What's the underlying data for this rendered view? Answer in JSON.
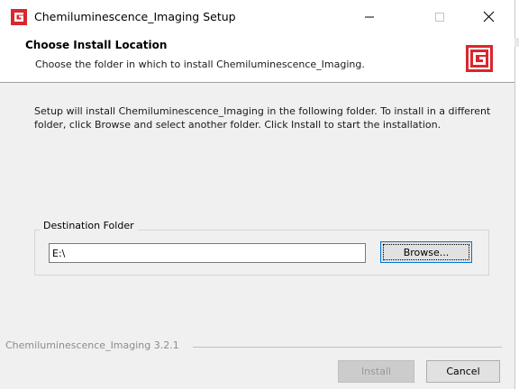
{
  "window": {
    "title": "Chemiluminescence_Imaging Setup",
    "controls": {
      "minimize": "—",
      "maximize": "☐",
      "close": "✕"
    }
  },
  "header": {
    "title": "Choose Install Location",
    "subtitle": "Choose the folder in which to install Chemiluminescence_Imaging."
  },
  "body": {
    "description": "Setup will install Chemiluminescence_Imaging in the following folder. To install in a different folder, click Browse and select another folder. Click Install to start the installation."
  },
  "destination": {
    "group_label": "Destination Folder",
    "path": "E:\\",
    "browse_label": "Browse..."
  },
  "footer": {
    "brand_text": "Chemiluminescence_Imaging 3.2.1",
    "install_label": "Install",
    "cancel_label": "Cancel"
  },
  "colors": {
    "brand_red": "#d9272e",
    "focus_blue": "#0078d7"
  },
  "icons": {
    "app": "app-logo-icon",
    "header": "header-logo-icon"
  }
}
